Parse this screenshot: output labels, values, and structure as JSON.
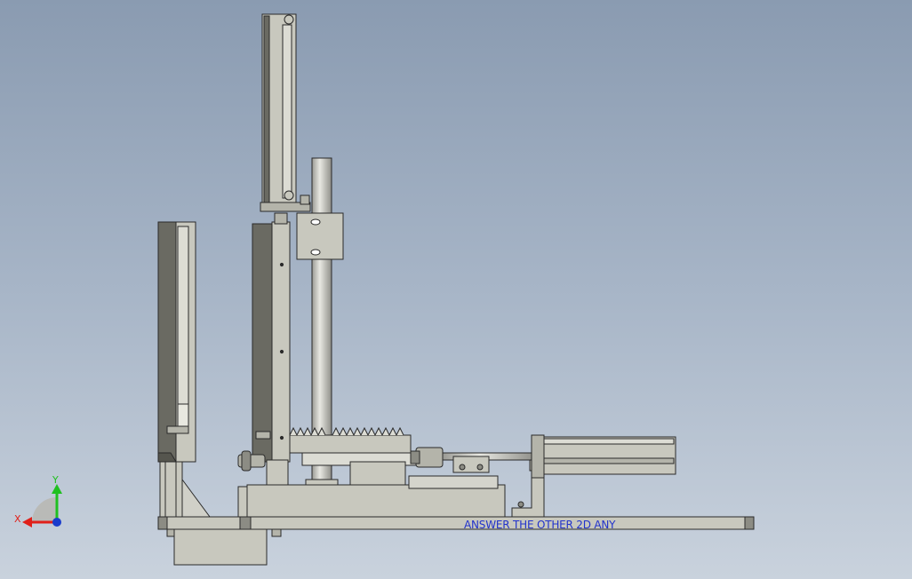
{
  "viewport": {
    "background_top": "#8a9bb1",
    "background_bottom": "#c9d2dd",
    "part_fill": "#c8c8be",
    "part_stroke": "#2a2a2a",
    "dark_plate": "#6a6a62"
  },
  "triad": {
    "x_label": "X",
    "y_label": "Y",
    "x_color": "#e0201a",
    "y_color": "#20c020",
    "z_color": "#1a3ccc"
  },
  "overlay": {
    "text": "ANSWER THE OTHER 2D ANY",
    "color": "#2233cc"
  }
}
